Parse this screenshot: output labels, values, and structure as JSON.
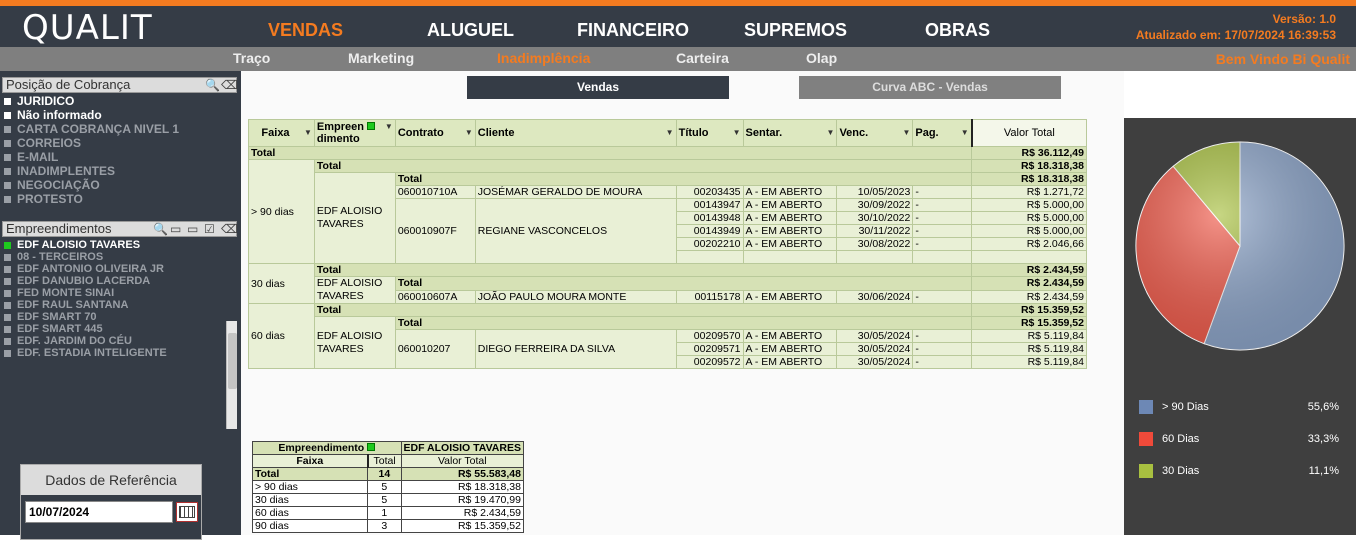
{
  "header": {
    "logo": "QUALIT",
    "nav": [
      "VENDAS",
      "ALUGUEL",
      "FINANCEIRO",
      "SUPREMOS",
      "OBRAS"
    ],
    "version": "Versão: 1.0",
    "updated": "Atualizado em: 17/07/2024 16:39:53",
    "accent": "#f47b20"
  },
  "subnav": {
    "items": [
      "Traço",
      "Marketing",
      "Inadimplência",
      "Carteira",
      "Olap"
    ],
    "welcome": "Bem Vindo Bi Qualit"
  },
  "cobranca": {
    "title": "Posição de Cobrança",
    "items": [
      "JURIDICO",
      "Não informado",
      "CARTA COBRANÇA NIVEL 1",
      "CORREIOS",
      "E-MAIL",
      "INADIMPLENTES",
      "NEGOCIAÇÃO",
      "PROTESTO"
    ]
  },
  "empreend": {
    "title": "Empreendimentos",
    "items": [
      "EDF ALOISIO TAVARES",
      "08 - TERCEIROS",
      "EDF ANTONIO OLIVEIRA JR",
      "EDF DANUBIO LACERDA",
      "FED MONTE SINAI",
      "EDF RAUL SANTANA",
      "EDF SMART 70",
      "EDF SMART 445",
      "EDF. JARDIM DO CÉU",
      "EDF. ESTADIA INTELIGENTE"
    ]
  },
  "ref": {
    "title": "Dados de Referência",
    "date": "10/07/2024"
  },
  "buttons": {
    "vendas": "Vendas",
    "curva": "Curva ABC - Vendas"
  },
  "pivot": {
    "headers": {
      "faixa": "Faixa",
      "empreend1": "Empreen",
      "empreend2": "dimento",
      "contrato": "Contrato",
      "cliente": "Cliente",
      "titulo": "Título",
      "sentar": "Sentar.",
      "venc": "Venc.",
      "pag": "Pag.",
      "valor": "Valor Total"
    },
    "total_label": "Total",
    "grand_total": "R$ 36.112,49",
    "groups": [
      {
        "faixa": "> 90 dias",
        "emp1": "EDF ALOISIO",
        "emp2": "TAVARES",
        "total": "R$ 18.318,38",
        "contracts": [
          {
            "contrato": "060010710A",
            "cliente": "JOSÉMAR GERALDO DE MOURA",
            "rows": [
              [
                "00203435",
                "A - EM ABERTO",
                "10/05/2023",
                "-",
                "R$ 1.271,72"
              ]
            ]
          },
          {
            "contrato": "060010907F",
            "cliente": "REGIANE VASCONCELOS",
            "rows": [
              [
                "00143947",
                "A - EM ABERTO",
                "30/09/2022",
                "-",
                "R$ 5.000,00"
              ],
              [
                "00143948",
                "A - EM ABERTO",
                "30/10/2022",
                "-",
                "R$ 5.000,00"
              ],
              [
                "00143949",
                "A - EM ABERTO",
                "30/11/2022",
                "-",
                "R$ 5.000,00"
              ],
              [
                "00202210",
                "A - EM ABERTO",
                "30/08/2022",
                "-",
                "R$ 2.046,66"
              ]
            ]
          }
        ]
      },
      {
        "faixa": "30 dias",
        "emp1": "EDF ALOISIO",
        "emp2": "TAVARES",
        "total": "R$ 2.434,59",
        "contracts": [
          {
            "contrato": "060010607A",
            "cliente": "JOÃO PAULO MOURA MONTE",
            "rows": [
              [
                "00115178",
                "A - EM ABERTO",
                "30/06/2024",
                "-",
                "R$ 2.434,59"
              ]
            ]
          }
        ]
      },
      {
        "faixa": "60 dias",
        "emp1": "EDF ALOISIO",
        "emp2": "TAVARES",
        "total": "R$ 15.359,52",
        "contracts": [
          {
            "contrato": "060010207",
            "cliente": "DIEGO FERREIRA DA SILVA",
            "rows": [
              [
                "00209570",
                "A - EM ABERTO",
                "30/05/2024",
                "-",
                "R$ 5.119,84"
              ],
              [
                "00209571",
                "A - EM ABERTO",
                "30/05/2024",
                "-",
                "R$ 5.119,84"
              ],
              [
                "00209572",
                "A - EM ABERTO",
                "30/05/2024",
                "-",
                "R$ 5.119,84"
              ]
            ]
          }
        ]
      }
    ]
  },
  "summary": {
    "h_emp": "Empreendimento",
    "emp_value": "EDF ALOISIO TAVARES",
    "h_faixa": "Faixa",
    "h_total": "Total",
    "h_valor": "Valor Total",
    "total_row": [
      "Total",
      "14",
      "R$ 55.583,48"
    ],
    "rows": [
      [
        "> 90 dias",
        "5",
        "R$ 18.318,38"
      ],
      [
        "30 dias",
        "5",
        "R$ 19.470,99"
      ],
      [
        "60 dias",
        "1",
        "R$ 2.434,59"
      ],
      [
        "90 dias",
        "3",
        "R$ 15.359,52"
      ]
    ]
  },
  "chart_data": {
    "type": "pie",
    "title": "",
    "slices": [
      {
        "label": "> 90 Dias",
        "value": 55.6,
        "display": "55,6%",
        "color": "#8ca4c8"
      },
      {
        "label": "60 Dias",
        "value": 33.3,
        "display": "33,3%",
        "color": "#f05a4a"
      },
      {
        "label": "30 Dias",
        "value": 11.1,
        "display": "11,1%",
        "color": "#a8c040"
      }
    ],
    "legend_position": "bottom"
  }
}
